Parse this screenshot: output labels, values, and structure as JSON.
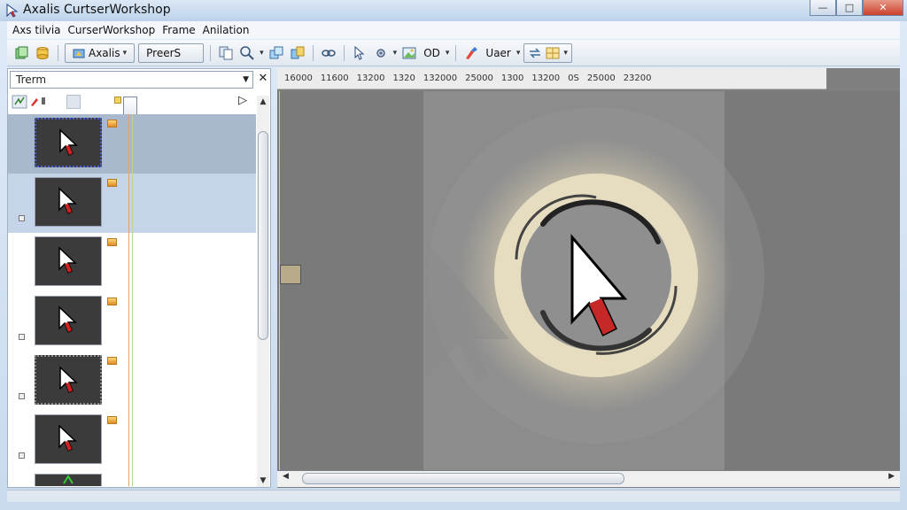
{
  "window": {
    "title": "Axalis CurtserWorkshop"
  },
  "menu": {
    "items": [
      "Axs tilvia",
      "CurserWorkshop",
      "Frame",
      "Anilation"
    ]
  },
  "toolbar": {
    "axalis_label": "Axalis",
    "preset_label": "PreerS",
    "op_label": "OD",
    "user_label": "Uaer"
  },
  "left_panel": {
    "filter_value": "Trerm",
    "frames": [
      "frame-1",
      "frame-2",
      "frame-3",
      "frame-4",
      "frame-5",
      "frame-6",
      "frame-7"
    ]
  },
  "ruler": {
    "labels": [
      "16000",
      "11600",
      "13200",
      "1320",
      "132000",
      "25000",
      "1300",
      "13200",
      "0S",
      "25000",
      "23200"
    ]
  },
  "colors": {
    "canvas_bg": "#7a7a7a",
    "selection_dark": "#a9b8cc",
    "selection_light": "#c6d4ea",
    "swirl": "#e6dcc0"
  }
}
